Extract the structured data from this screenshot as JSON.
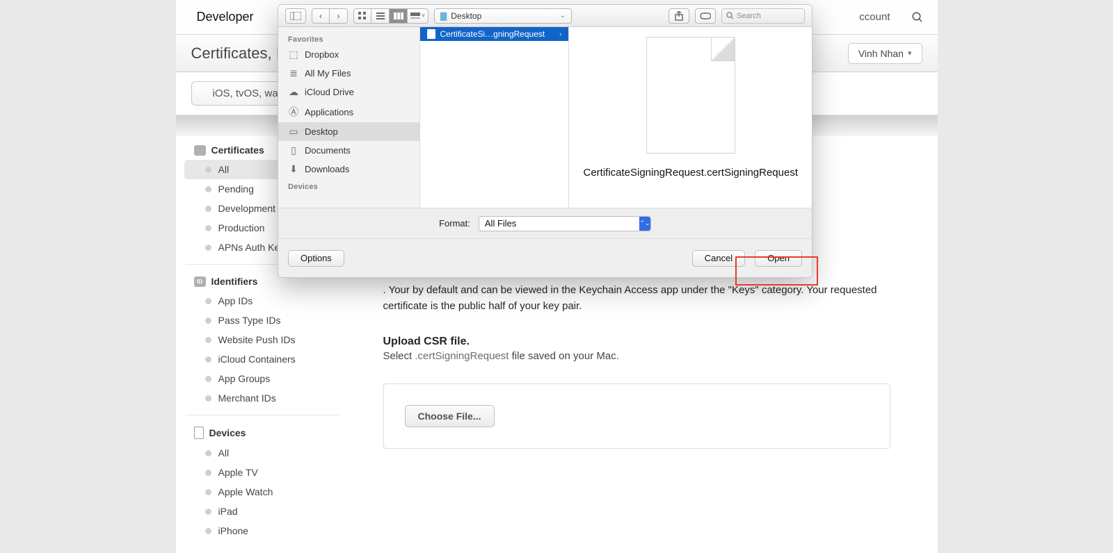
{
  "nav": {
    "brand": "Developer",
    "account": "ccount"
  },
  "titlebar": {
    "title": "Certificates, I",
    "user": "Vinh Nhan"
  },
  "tabs": {
    "platform": "iOS, tvOS, wat"
  },
  "sidebar": {
    "groups": [
      {
        "title": "Certificates",
        "items": [
          "All",
          "Pending",
          "Development",
          "Production",
          "APNs Auth Key"
        ],
        "selected": 0
      },
      {
        "title": "Identifiers",
        "badge": "ID",
        "items": [
          "App IDs",
          "Pass Type IDs",
          "Website Push IDs",
          "iCloud Containers",
          "App Groups",
          "Merchant IDs"
        ]
      },
      {
        "title": "Devices",
        "items": [
          "All",
          "Apple TV",
          "Apple Watch",
          "iPad",
          "iPhone"
        ]
      }
    ]
  },
  "content": {
    "paragraph_tail": ". Your by default and can be viewed in the Keychain Access app under the \"Keys\" category. Your requested certificate is the public half of your key pair.",
    "upload_title": "Upload CSR file.",
    "upload_pre": "Select ",
    "upload_ext": ".certSigningRequest",
    "upload_post": " file saved on your Mac.",
    "choose": "Choose File..."
  },
  "finder": {
    "location": "Desktop",
    "search_placeholder": "Search",
    "favorites_header": "Favorites",
    "devices_header": "Devices",
    "favorites": [
      "Dropbox",
      "All My Files",
      "iCloud Drive",
      "Applications",
      "Desktop",
      "Documents",
      "Downloads"
    ],
    "favorites_icons": [
      "⌥",
      "▤",
      "☁",
      "⌘",
      "▥",
      "▭",
      "⬇"
    ],
    "favorite_selected": 4,
    "file_short": "CertificateSi…gningRequest",
    "file_long": "CertificateSigningRequest.certSigningRequest",
    "format_label": "Format:",
    "format_value": "All Files",
    "buttons": {
      "options": "Options",
      "cancel": "Cancel",
      "open": "Open"
    }
  }
}
